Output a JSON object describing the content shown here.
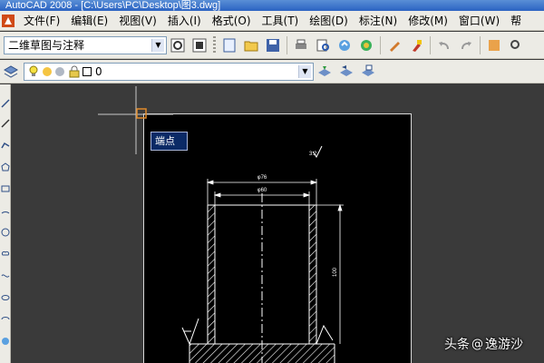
{
  "window": {
    "title": "AutoCAD 2008 - [C:\\Users\\PC\\Desktop\\图3.dwg]"
  },
  "menu": {
    "items": [
      "文件(F)",
      "编辑(E)",
      "视图(V)",
      "插入(I)",
      "格式(O)",
      "工具(T)",
      "绘图(D)",
      "标注(N)",
      "修改(M)",
      "窗口(W)",
      "帮"
    ]
  },
  "workspace": {
    "selected": "二维草图与注释"
  },
  "layer": {
    "current": "0"
  },
  "drawing": {
    "tooltip": "端点",
    "dim_top": "φ76",
    "dim_inner": "φ60",
    "dim_height": "100",
    "roughness_label": "3.2"
  },
  "watermark": {
    "prefix": "头条",
    "at": "@",
    "name": "逸游沙"
  },
  "colors": {
    "drawing_bg": "#000000",
    "model_bg": "#3a3a3a",
    "toolbar_bg": "#ecebe5",
    "title_bar": "#2b63c2"
  }
}
